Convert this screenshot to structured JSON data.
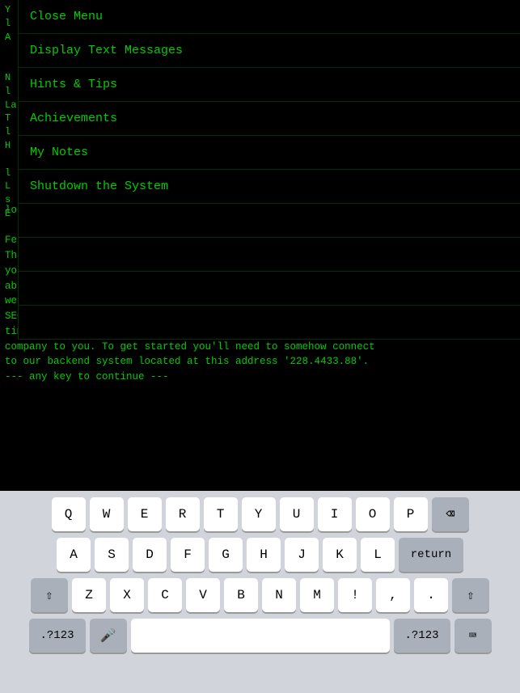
{
  "menu": {
    "items": [
      {
        "id": "close-menu",
        "label": "Close Menu"
      },
      {
        "id": "display-text-messages",
        "label": "Display Text Messages"
      },
      {
        "id": "hints-tips",
        "label": "Hints & Tips"
      },
      {
        "id": "achievements",
        "label": "Achievements"
      },
      {
        "id": "my-notes",
        "label": "My Notes"
      },
      {
        "id": "shutdown",
        "label": "Shutdown the System"
      }
    ]
  },
  "terminal": {
    "prompt_line": "localhost.mail> offer",
    "lines": [
      "Fetching email 'offer'",
      "Thank you for accepting our offer. While our records indicate",
      "you possess an impressive array of skills, we doubt you will be",
      "able to hack into our systems. Nonetheless, as stated in the",
      "website for 'Head Office for Legal Examinations of Your",
      "SECURITY', we are required to have you people try from time to",
      "time. Please understand that we cannot divulge the name of our",
      "company to you. To get started you'll need to somehow connect",
      "to our backend system located at this address '228.4433.88'.",
      "--- any key to continue ---"
    ]
  },
  "keyboard": {
    "rows": [
      [
        "Q",
        "W",
        "E",
        "R",
        "T",
        "Y",
        "U",
        "I",
        "O",
        "P"
      ],
      [
        "A",
        "S",
        "D",
        "F",
        "G",
        "H",
        "J",
        "K",
        "L"
      ],
      [
        "⇧",
        "Z",
        "X",
        "C",
        "V",
        "B",
        "N",
        "M",
        "!",
        ",",
        ".",
        "⇧"
      ],
      [
        ".?123",
        "🎤",
        "",
        "",
        ".?123",
        "⌨"
      ]
    ],
    "space_label": "",
    "backspace_label": "⌫",
    "return_label": "return"
  }
}
